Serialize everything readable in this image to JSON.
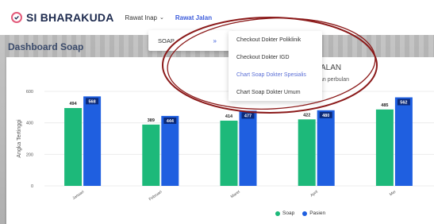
{
  "header": {
    "brand": "SI BHARAKUDA",
    "nav": [
      {
        "label": "Rawat Inap",
        "has_caret": true
      },
      {
        "label": "Rawat Jalan",
        "has_caret": false
      }
    ]
  },
  "page_title": "Dashboard Soap",
  "soap_menu": {
    "label": "SOAP",
    "arrow": "»"
  },
  "sub_menu": [
    "Checkout Dokter Poliklinik",
    "Checkout Dokter IGD",
    "Chart Soap Dokter Spesialis",
    "Chart Soap Dokter Umum"
  ],
  "chart_data": {
    "type": "bar",
    "title": "ALAN",
    "subtitle": "jalan perbulan",
    "categories": [
      "Januari",
      "Februari",
      "Maret",
      "April",
      "Mei"
    ],
    "series": [
      {
        "name": "Soap",
        "color": "#1db97a",
        "values": [
          494,
          389,
          414,
          422,
          485
        ]
      },
      {
        "name": "Pasien",
        "color": "#1f5fe0",
        "values": [
          568,
          444,
          477,
          480,
          562
        ]
      }
    ],
    "ylabel": "Angka Tertinggi",
    "ylim": [
      0,
      600
    ],
    "yticks": [
      0,
      200,
      400,
      600
    ],
    "grid": true,
    "legend": "bottom"
  },
  "colors": {
    "annotation": "#8b1a1a",
    "brand_accent": "#e25a7a"
  }
}
